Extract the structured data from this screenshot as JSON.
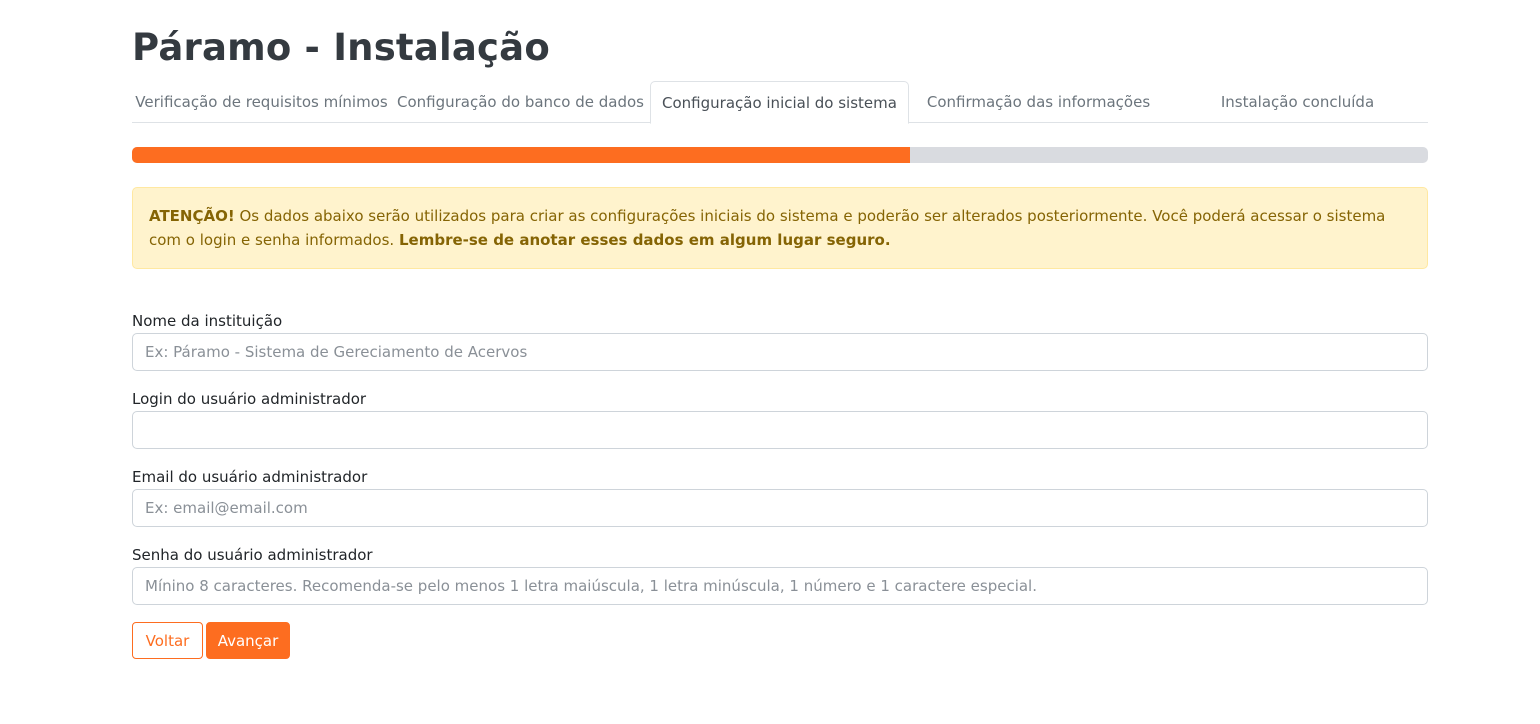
{
  "header": {
    "title": "Páramo - Instalação"
  },
  "steps": [
    {
      "label": "Verificação de requisitos mínimos",
      "active": false
    },
    {
      "label": "Configuração do banco de dados",
      "active": false
    },
    {
      "label": "Configuração inicial do sistema",
      "active": true
    },
    {
      "label": "Confirmação das informações",
      "active": false
    },
    {
      "label": "Instalação concluída",
      "active": false
    }
  ],
  "progress": {
    "percent": 60,
    "fill_color": "#fd6d20",
    "track_color": "#d9dbe0"
  },
  "alert": {
    "strong_prefix": "ATENÇÃO!",
    "text": " Os dados abaixo serão utilizados para criar as configurações iniciais do sistema e poderão ser alterados posteriormente. Você poderá acessar o sistema com o login e senha informados. ",
    "strong_suffix": "Lembre-se de anotar esses dados em algum lugar seguro."
  },
  "form": {
    "institution": {
      "label": "Nome da instituição",
      "value": "",
      "placeholder": "Ex: Páramo - Sistema de Gereciamento de Acervos"
    },
    "admin_login": {
      "label": "Login do usuário administrador",
      "value": "",
      "placeholder": ""
    },
    "admin_email": {
      "label": "Email do usuário administrador",
      "value": "",
      "placeholder": "Ex: email@email.com"
    },
    "admin_password": {
      "label": "Senha do usuário administrador",
      "value": "",
      "placeholder": "Mínino 8 caracteres. Recomenda-se pelo menos 1 letra maiúscula, 1 letra minúscula, 1 número e 1 caractere especial."
    }
  },
  "actions": {
    "back_label": "Voltar",
    "next_label": "Avançar"
  },
  "colors": {
    "accent": "#fd6d20",
    "alert_bg": "#fff3cd",
    "alert_text": "#856404"
  }
}
